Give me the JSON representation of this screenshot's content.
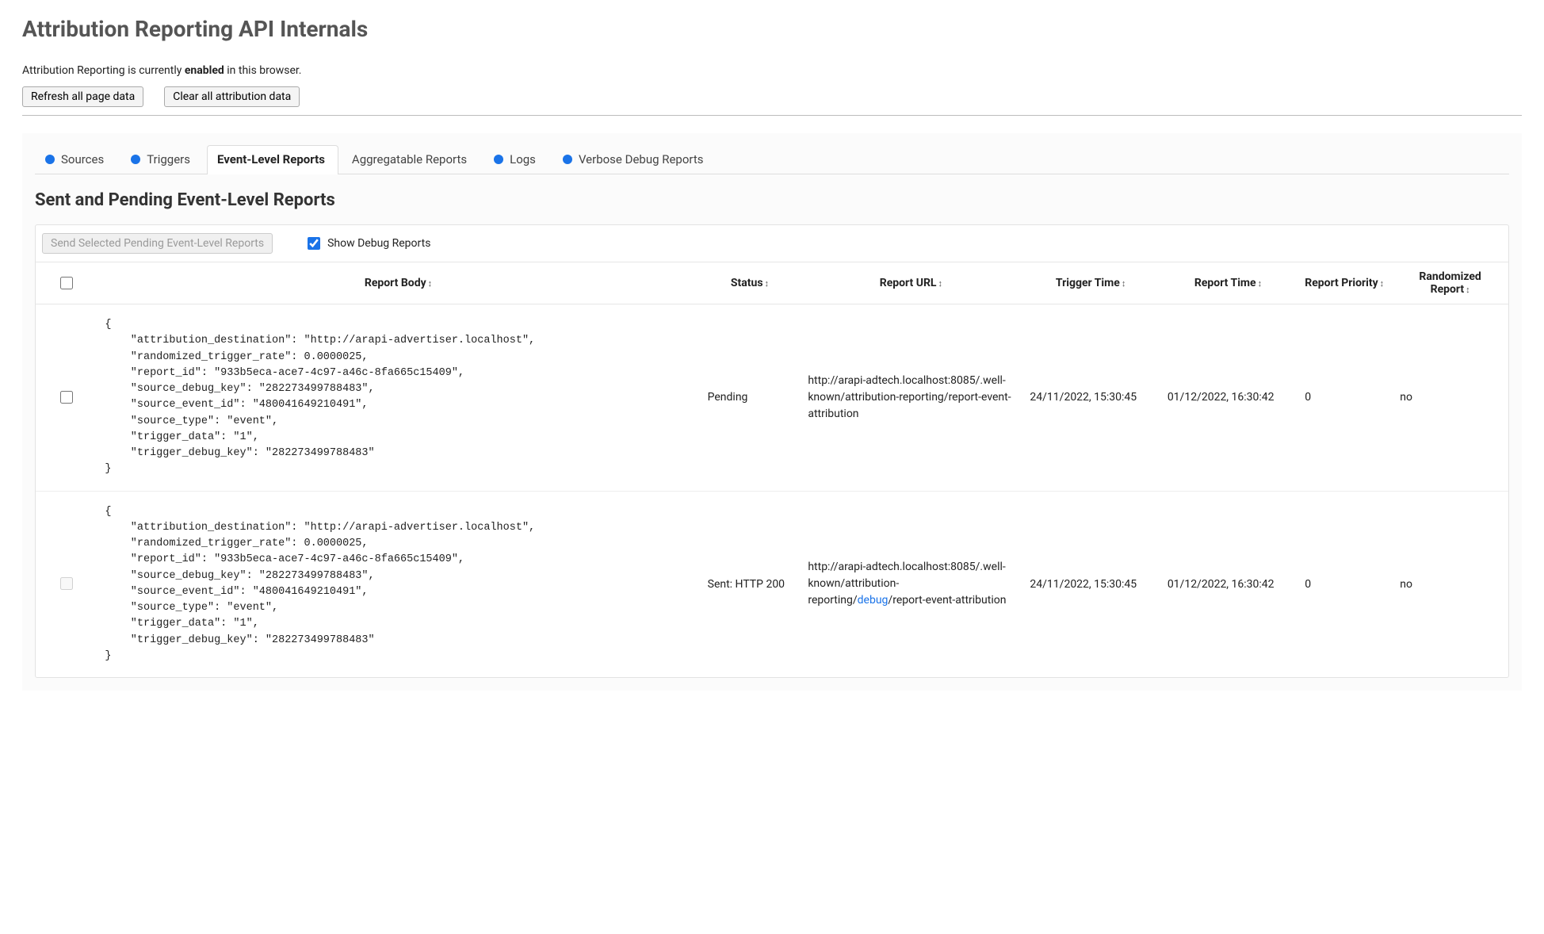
{
  "header": {
    "title": "Attribution Reporting API Internals",
    "status_prefix": "Attribution Reporting is currently ",
    "status_bold": "enabled",
    "status_suffix": " in this browser.",
    "refresh_btn": "Refresh all page data",
    "clear_btn": "Clear all attribution data"
  },
  "tabs": [
    {
      "label": "Sources",
      "dot": true,
      "active": false
    },
    {
      "label": "Triggers",
      "dot": true,
      "active": false
    },
    {
      "label": "Event-Level Reports",
      "dot": false,
      "active": true
    },
    {
      "label": "Aggregatable Reports",
      "dot": false,
      "active": false
    },
    {
      "label": "Logs",
      "dot": true,
      "active": false
    },
    {
      "label": "Verbose Debug Reports",
      "dot": true,
      "active": false
    }
  ],
  "section_title": "Sent and Pending Event-Level Reports",
  "toolbar": {
    "send_btn": "Send Selected Pending Event-Level Reports",
    "show_debug_label": "Show Debug Reports",
    "show_debug_checked": true
  },
  "columns": {
    "body": "Report Body",
    "status": "Status",
    "url": "Report URL",
    "trigger": "Trigger Time",
    "report": "Report Time",
    "prio": "Report Priority",
    "rand": "Randomized Report"
  },
  "rows": [
    {
      "checkbox_enabled": true,
      "body_json": {
        "attribution_destination": "http://arapi-advertiser.localhost",
        "randomized_trigger_rate": 2.5e-06,
        "report_id": "933b5eca-ace7-4c97-a46c-8fa665c15409",
        "source_debug_key": "282273499788483",
        "source_event_id": "480041649210491",
        "source_type": "event",
        "trigger_data": "1",
        "trigger_debug_key": "282273499788483"
      },
      "status": "Pending",
      "url_parts": [
        "http://arapi-adtech.localhost:8085/.well-known/attribution-reporting/report-event-attribution"
      ],
      "trigger_time": "24/11/2022, 15:30:45",
      "report_time": "01/12/2022, 16:30:42",
      "priority": "0",
      "randomized": "no"
    },
    {
      "checkbox_enabled": false,
      "body_json": {
        "attribution_destination": "http://arapi-advertiser.localhost",
        "randomized_trigger_rate": 2.5e-06,
        "report_id": "933b5eca-ace7-4c97-a46c-8fa665c15409",
        "source_debug_key": "282273499788483",
        "source_event_id": "480041649210491",
        "source_type": "event",
        "trigger_data": "1",
        "trigger_debug_key": "282273499788483"
      },
      "status": "Sent: HTTP 200",
      "url_parts": [
        "http://arapi-adtech.localhost:8085/.well-known/attribution-reporting/",
        "debug",
        "/report-event-attribution"
      ],
      "trigger_time": "24/11/2022, 15:30:45",
      "report_time": "01/12/2022, 16:30:42",
      "priority": "0",
      "randomized": "no"
    }
  ]
}
